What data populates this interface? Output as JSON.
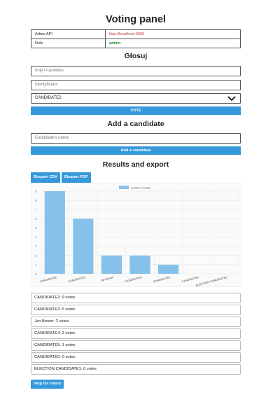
{
  "title": "Voting panel",
  "info": [
    {
      "key": "Adres API",
      "value": "http://localhost:3000",
      "color": "#c0392b"
    },
    {
      "key": "Role",
      "value": "admin",
      "color": "#1e8a2e"
    }
  ],
  "vote": {
    "heading": "Głosuj",
    "name_placeholder": "Imię i nazwisko",
    "id_placeholder": "Identyfikator",
    "selected_candidate": "CANDIDATE2",
    "vote_button": "VOTE"
  },
  "add": {
    "heading": "Add a candidate",
    "name_placeholder": "Candidate's name",
    "button": "Add a candidate"
  },
  "results": {
    "heading": "Results and export",
    "export_csv": "Eksport CSV",
    "export_pdf": "Eksport PDF",
    "items": [
      "CANDIDATE2: 9 votes",
      "CANDIDATE3: 6 votes",
      "Jan Brown: 2 votes",
      "CANDIDATE4: 2 votes",
      "CANDIDATE5: 1 votes",
      "CANDIDATE0: 0 votes",
      "ELECTION CANDIDATE1: 0 votes"
    ],
    "help_button": "Help for voters"
  },
  "chart_data": {
    "type": "bar",
    "categories": [
      "CANDIDATE2",
      "CANDIDATE3",
      "Jan Brown",
      "CANDIDATE4",
      "CANDIDATE5",
      "CANDIDATE0",
      "ELECTION CANDIDATE1"
    ],
    "series": [
      {
        "name": "Number of votes",
        "values": [
          9,
          6,
          2,
          2,
          1,
          0,
          0
        ]
      }
    ],
    "ylim": [
      0,
      9
    ],
    "yticks": [
      0,
      1,
      2,
      3,
      4,
      5,
      6,
      7,
      8,
      9
    ],
    "grid": true,
    "legend": "top-center",
    "bar_color": "#85c1ea"
  }
}
